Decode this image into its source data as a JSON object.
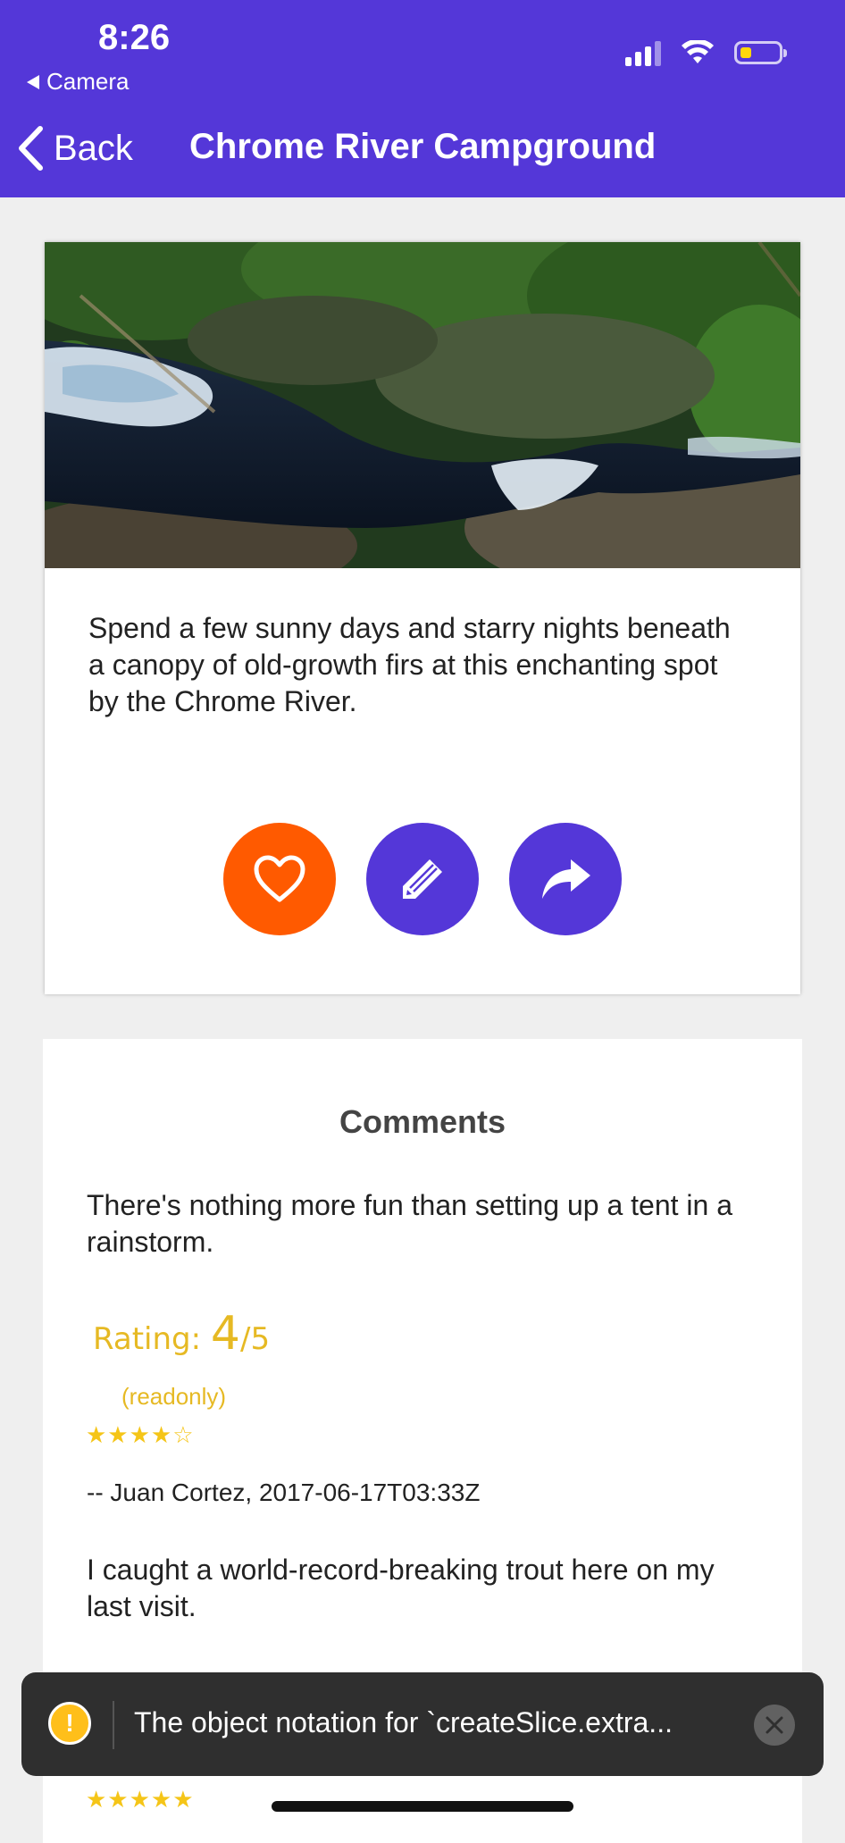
{
  "status_bar": {
    "time": "8:26",
    "back_app": "Camera"
  },
  "header": {
    "back_label": "Back",
    "title": "Chrome River Campground",
    "background_color": "#5437d8"
  },
  "campground": {
    "image_alt": "river-rapids-photo",
    "description": "Spend a few sunny days and starry nights beneath a canopy of old-growth firs at this enchanting spot by the Chrome River."
  },
  "actions": [
    {
      "icon": "heart-icon",
      "color": "#ff5a00"
    },
    {
      "icon": "pencil-icon",
      "color": "#5437d8"
    },
    {
      "icon": "share-icon",
      "color": "#5437d8"
    }
  ],
  "comments": {
    "title": "Comments",
    "items": [
      {
        "text": "There's nothing more fun than setting up a tent in a rainstorm.",
        "rating_prefix": "Rating:",
        "rating_value": "4",
        "rating_max": "/5",
        "readonly_label": "(readonly)",
        "stars": "★★★★☆",
        "rating": 4,
        "author_line": "-- Juan Cortez, 2017-06-17T03:33Z"
      },
      {
        "text": "I caught a world-record-breaking trout here on my last visit.",
        "stars": "★★★★★",
        "rating": 5
      }
    ]
  },
  "toast": {
    "message": "The object notation for `createSlice.extra...",
    "icon": "warning-icon"
  }
}
